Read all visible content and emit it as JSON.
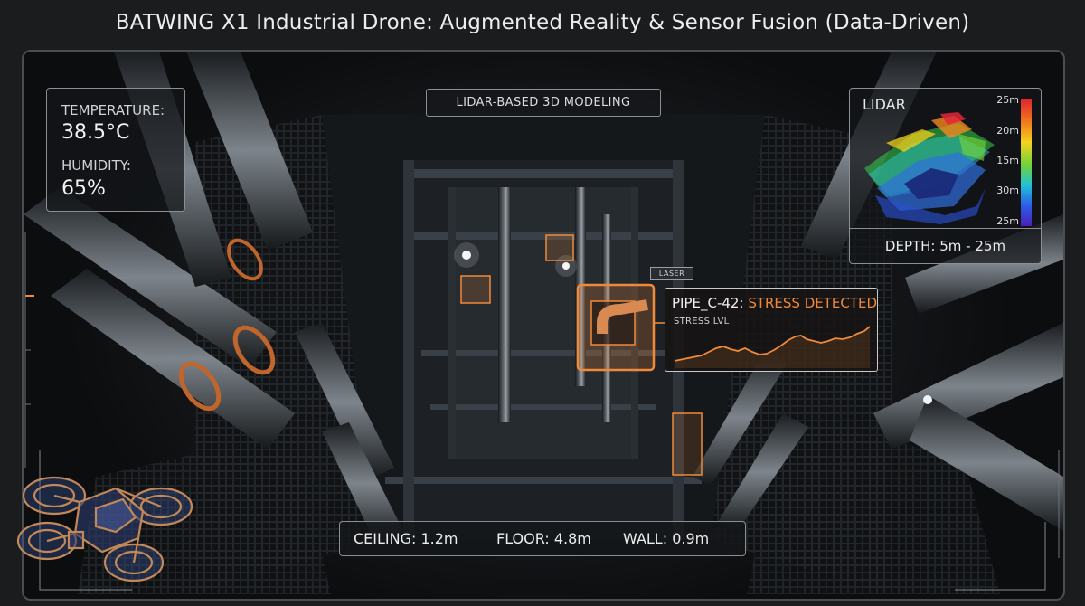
{
  "title": "BATWING X1 Industrial Drone: Augmented Reality & Sensor Fusion (Data-Driven)",
  "env": {
    "temperature_label": "TEMPERATURE:",
    "temperature_value": "38.5°C",
    "humidity_label": "HUMIDITY:",
    "humidity_value": "65%"
  },
  "center_label": "LIDAR-BASED 3D MODELING",
  "lidar": {
    "title": "LIDAR",
    "colorbar_ticks": [
      "25m",
      "20m",
      "15m",
      "30m",
      "25m"
    ],
    "footer": "DEPTH: 5m - 25m"
  },
  "target": {
    "tag": "LASER",
    "name": "PIPE_C-42:",
    "status": "STRESS DETECTED",
    "chart_label": "STRESS LVL"
  },
  "measurements": {
    "ceiling": "CEILING: 1.2m",
    "floor": "FLOOR: 4.8m",
    "wall": "WALL: 0.9m"
  },
  "colors": {
    "accent_orange": "#f08a3a",
    "panel_border": "#8b8f95",
    "background": "#1b1c1e"
  },
  "icons": [
    "drone-icon"
  ]
}
